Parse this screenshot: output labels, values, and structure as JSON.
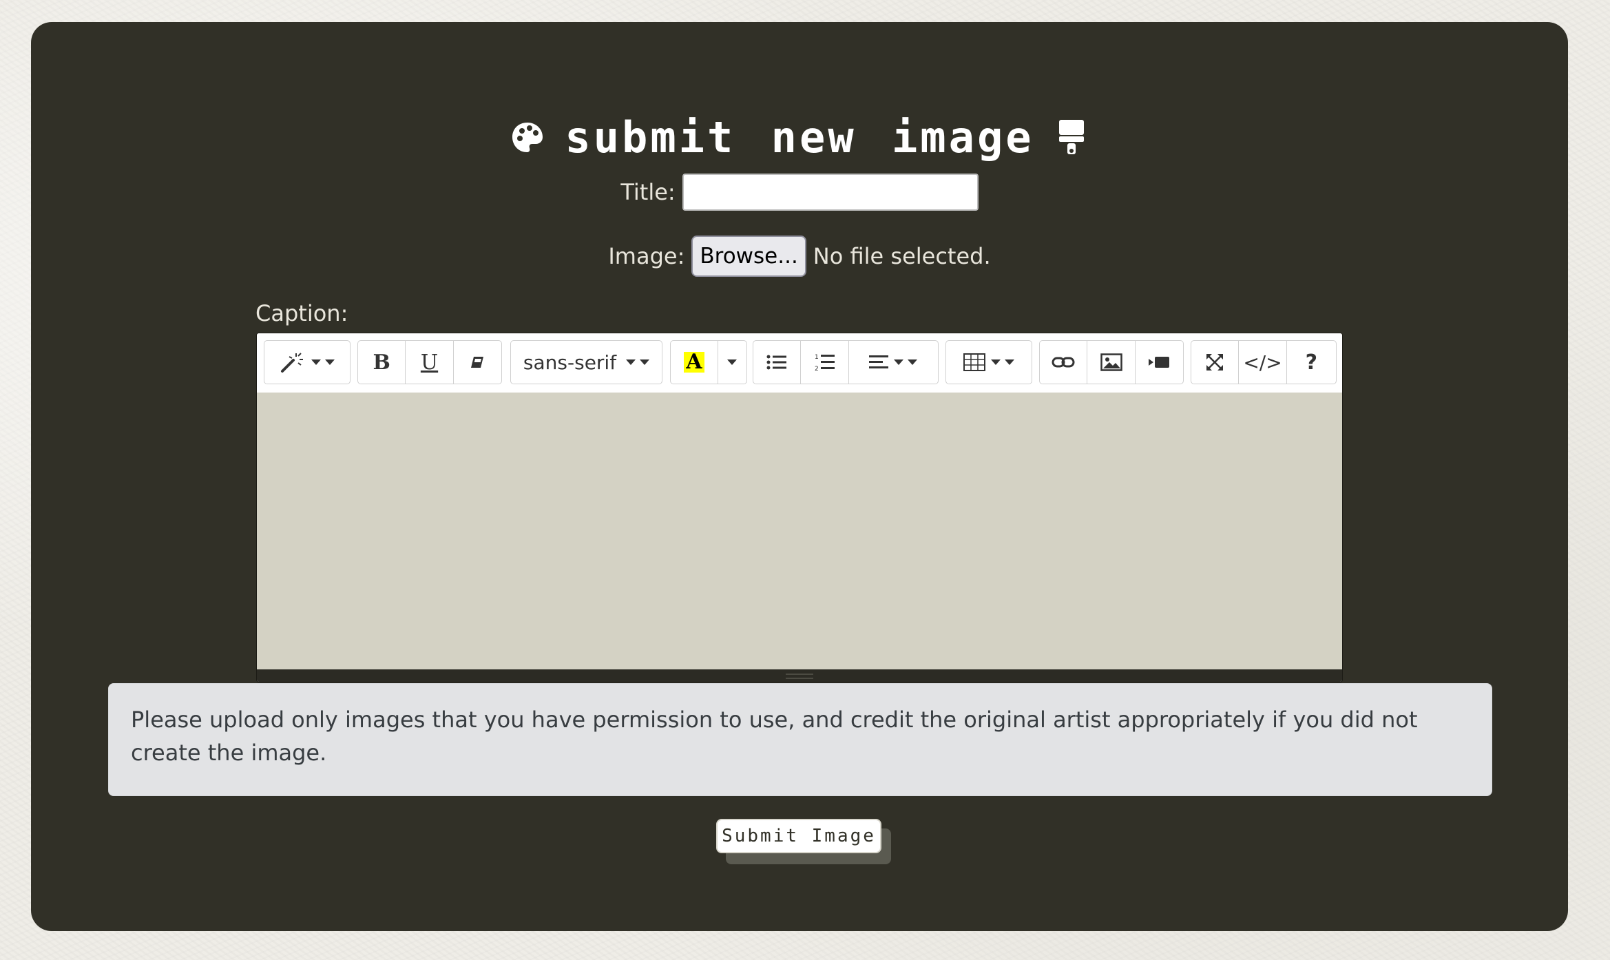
{
  "heading": {
    "text": "submit new image",
    "left_icon": "palette-icon",
    "right_icon": "paintbrush-icon"
  },
  "title_field": {
    "label": "Title:",
    "value": ""
  },
  "image_field": {
    "label": "Image:",
    "browse_label": "Browse...",
    "status": "No file selected."
  },
  "caption": {
    "label": "Caption:",
    "toolbar": {
      "style_icon": "magic-wand-icon",
      "bold_label": "B",
      "underline_label": "U",
      "clear_format_icon": "eraser-icon",
      "font_family": "sans-serif",
      "color_label": "A",
      "unordered_list_icon": "bulleted-list-icon",
      "ordered_list_icon": "numbered-list-icon",
      "paragraph_icon": "align-left-icon",
      "table_icon": "table-icon",
      "link_icon": "link-icon",
      "picture_icon": "picture-icon",
      "video_icon": "video-icon",
      "fullscreen_icon": "fullscreen-icon",
      "codeview_label": "</>",
      "help_label": "?"
    },
    "content": ""
  },
  "notice": {
    "text": "Please upload only images that you have permission to use, and credit the original artist appropriately if you did not create the image."
  },
  "submit": {
    "label": "Submit Image"
  },
  "colors": {
    "page_background": "#efede7",
    "panel": "#313027",
    "editor_area": "#d4d2c4",
    "notice_background": "#e2e3e5",
    "highlight_yellow": "#ffff00"
  }
}
